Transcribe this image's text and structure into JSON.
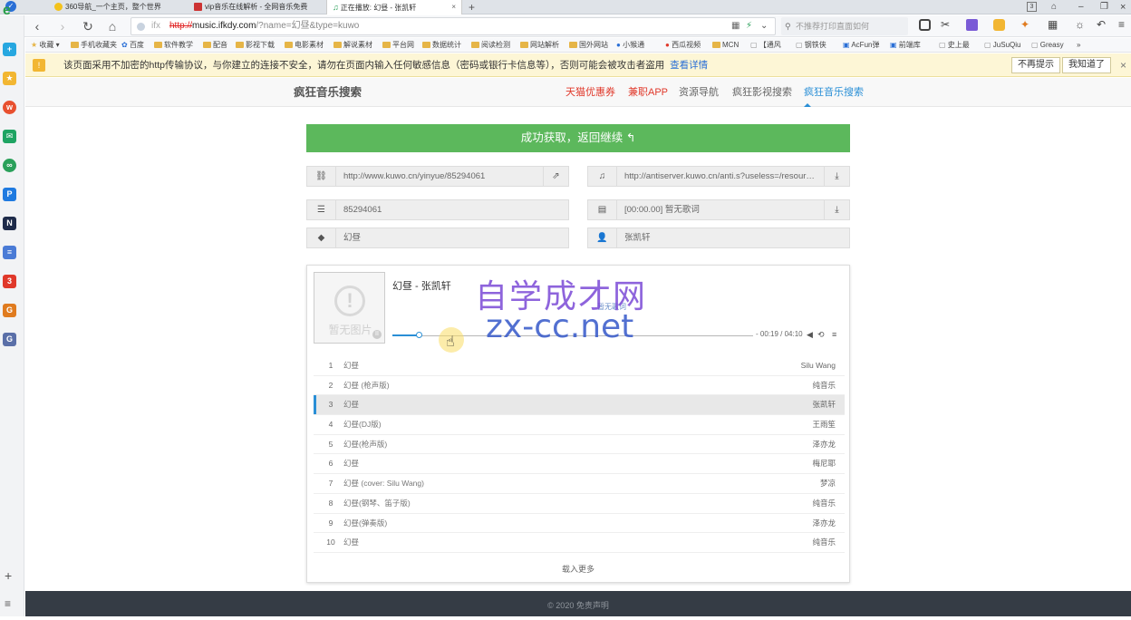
{
  "browser": {
    "tabs": [
      {
        "label": "360导航_一个主页，整个世界"
      },
      {
        "label": "vip音乐在线解析 - 全网音乐免费"
      },
      {
        "label": "正在播放: 幻昼 - 张凯轩"
      }
    ],
    "tab_add": "+",
    "tab_counter": "3",
    "url_prefix": "ifx",
    "url_scheme": "http://",
    "url_host": "music.ifkdy.com",
    "url_path": "/?name=幻昼&type=kuwo",
    "search_placeholder": "不推荐打印直面如何",
    "bookmarks": [
      "收藏",
      "手机收藏夹",
      "百度",
      "软件教学",
      "配音",
      "影视下载",
      "电影素材",
      "解说素材",
      "平台网",
      "数据统计",
      "阅读检测",
      "网站解析",
      "国外网站",
      "小猴通",
      "西瓜视频",
      "MCN",
      "【通风",
      "钢铁侠",
      "AcFun弹",
      "前端库",
      "史上最",
      "JuSuQiu",
      "Greasy",
      "»"
    ],
    "warning": {
      "text": "该页面采用不加密的http传输协议，与你建立的连接不安全，请勿在页面内输入任何敏感信息（密码或银行卡信息等），否则可能会被攻击者盗用",
      "link": "查看详情",
      "btn_no_remind": "不再提示",
      "btn_got_it": "我知道了",
      "close": "×"
    }
  },
  "site": {
    "brand": "疯狂音乐搜索",
    "menu": [
      "天猫优惠券",
      "兼职APP",
      "资源导航",
      "疯狂影视搜索",
      "疯狂音乐搜索"
    ],
    "success_label": "成功获取，返回继续 ↰",
    "fields": {
      "link": "http://www.kuwo.cn/yinyue/85294061",
      "audio": "http://antiserver.kuwo.cn/anti.s?useless=/resource/...",
      "song_id": "85294061",
      "lyric": "[00:00.00] 暂无歌词",
      "name": "幻昼",
      "author": "张凯轩"
    },
    "player": {
      "cover_text": "暂无图片",
      "song_title": "幻昼 - 张凯轩",
      "no_lyric": "暂无歌词",
      "time": "- 00:19 / 04:10",
      "progress_fraction": 0.076,
      "playlist": [
        {
          "num": "1",
          "title": "幻昼",
          "author": "Silu Wang"
        },
        {
          "num": "2",
          "title": "幻昼 (枪声版)",
          "author": "纯音乐"
        },
        {
          "num": "3",
          "title": "幻昼",
          "author": "张凯轩"
        },
        {
          "num": "4",
          "title": "幻昼(DJ版)",
          "author": "王雨笙"
        },
        {
          "num": "5",
          "title": "幻昼(枪声版)",
          "author": "泽亦龙"
        },
        {
          "num": "6",
          "title": "幻昼",
          "author": "梅尼耶"
        },
        {
          "num": "7",
          "title": "幻昼 (cover: Silu Wang)",
          "author": "梦凉"
        },
        {
          "num": "8",
          "title": "幻昼(钢琴、笛子版)",
          "author": "纯音乐"
        },
        {
          "num": "9",
          "title": "幻昼(弹奏版)",
          "author": "泽亦龙"
        },
        {
          "num": "10",
          "title": "幻昼",
          "author": "纯音乐"
        }
      ],
      "current_index": 2,
      "load_more": "载入更多"
    },
    "footer": "© 2020 免责声明"
  },
  "watermark": {
    "line1": "自学成才网",
    "line2": "zx-cc.net"
  },
  "colors": {
    "success": "#5cb85c",
    "accent": "#2a8fd6",
    "footer": "#353c45",
    "warning_bg": "#fdf6d6"
  }
}
